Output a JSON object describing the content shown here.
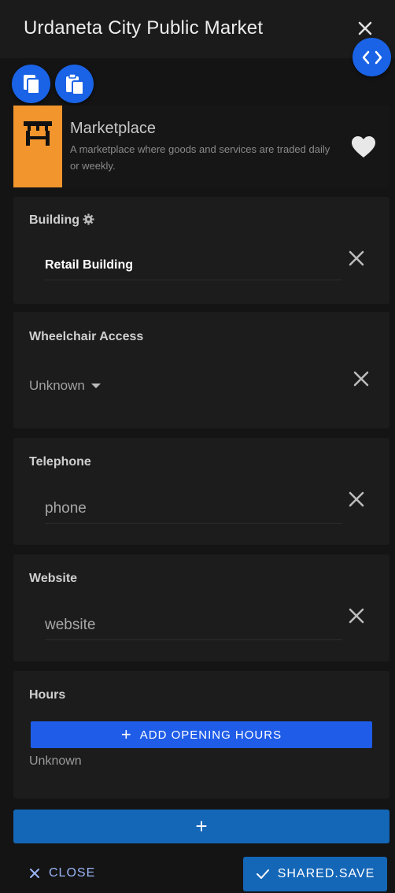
{
  "header": {
    "title": "Urdaneta City Public Market"
  },
  "preset": {
    "name": "Marketplace",
    "description": "A marketplace where goods and services are traded daily or weekly.",
    "icon": "market-stall-icon",
    "icon_bg": "#f1952c"
  },
  "fields": {
    "building": {
      "label": "Building",
      "value": "Retail Building"
    },
    "wheelchair": {
      "label": "Wheelchair Access",
      "value": "Unknown"
    },
    "telephone": {
      "label": "Telephone",
      "placeholder": "phone"
    },
    "website": {
      "label": "Website",
      "placeholder": "website"
    },
    "hours": {
      "label": "Hours",
      "button_label": "ADD OPENING HOURS",
      "value": "Unknown"
    }
  },
  "footer": {
    "close_label": "CLOSE",
    "save_label": "SHARED.SAVE"
  },
  "colors": {
    "accent_blue": "#1a63e6",
    "action_blue": "#1466b7",
    "background": "#141414"
  }
}
